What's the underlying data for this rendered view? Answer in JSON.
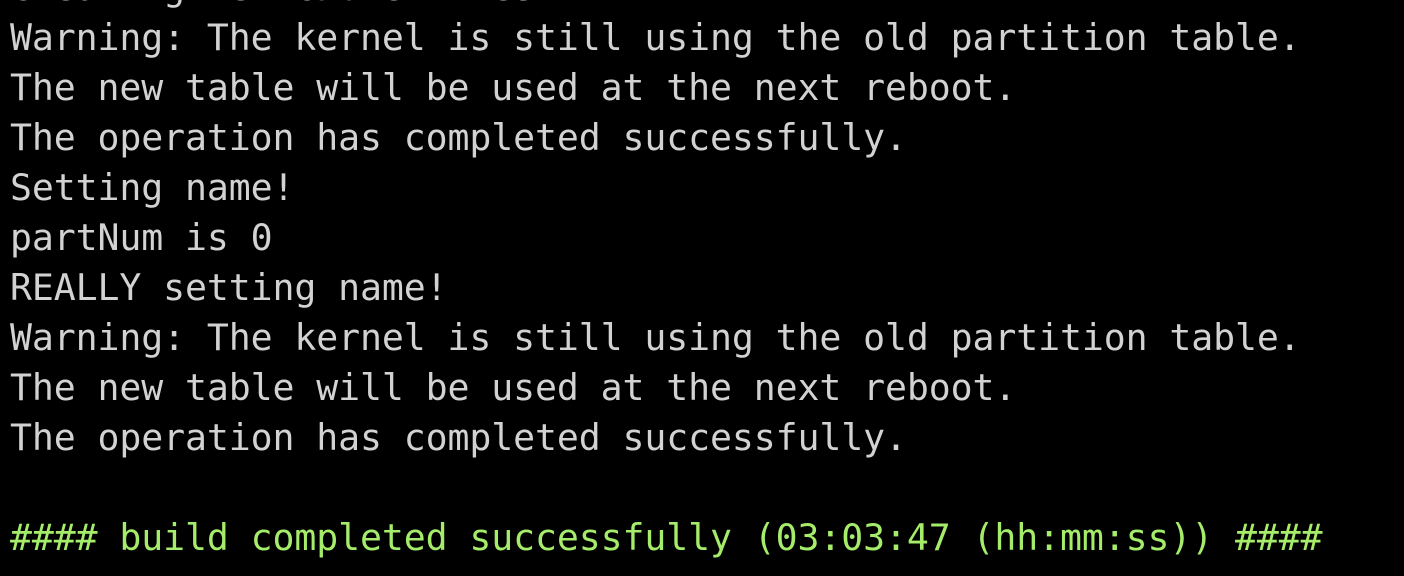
{
  "terminal": {
    "lines": [
      "Creating new GPT entries.",
      "Warning: The kernel is still using the old partition table.",
      "The new table will be used at the next reboot.",
      "The operation has completed successfully.",
      "Setting name!",
      "partNum is 0",
      "REALLY setting name!",
      "Warning: The kernel is still using the old partition table.",
      "The new table will be used at the next reboot.",
      "The operation has completed successfully.",
      "",
      "#### build completed successfully (03:03:47 (hh:mm:ss)) ####"
    ]
  },
  "colors": {
    "text": "#d2d2d2",
    "success": "#a5ec6a",
    "background": "#000000"
  }
}
